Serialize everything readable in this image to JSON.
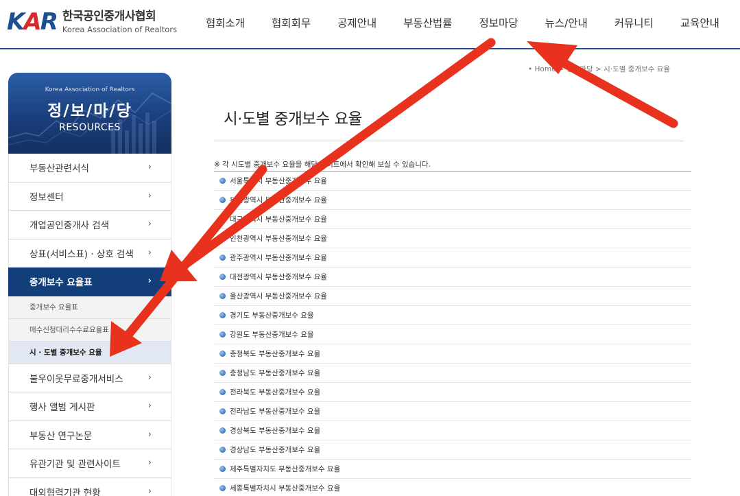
{
  "header": {
    "logo": {
      "mark_k": "K",
      "mark_a": "A",
      "mark_r": "R",
      "name_ko": "한국공인중개사협회",
      "name_en": "Korea Association of Realtors"
    },
    "nav": [
      "협회소개",
      "협회회무",
      "공제안내",
      "부동산법률",
      "정보마당",
      "뉴스/안내",
      "커뮤니티",
      "교육안내"
    ]
  },
  "sidebar": {
    "banner": {
      "org": "Korea Association of Realtors",
      "title": "정/보/마/당",
      "subtitle": "RESOURCES"
    },
    "items": [
      {
        "label": "부동산관련서식",
        "chevron": "›"
      },
      {
        "label": "정보센터",
        "chevron": "›"
      },
      {
        "label": "개업공인중개사 검색",
        "chevron": "›"
      },
      {
        "label": "상표(서비스표) · 상호 검색",
        "chevron": "›"
      },
      {
        "label": "중개보수 요율표",
        "chevron": "›"
      }
    ],
    "sub_items": [
      "중개보수 요율표",
      "매수신청대리수수료요율표",
      "시 · 도별 중개보수 요율"
    ],
    "items_after": [
      {
        "label": "불우이웃무료중개서비스",
        "chevron": "›"
      },
      {
        "label": "행사 앨범 게시판",
        "chevron": "›"
      },
      {
        "label": "부동산 연구논문",
        "chevron": "›"
      },
      {
        "label": "유관기관 및 관련사이트",
        "chevron": "›"
      },
      {
        "label": "대외협력기관 현황",
        "chevron": "›"
      }
    ]
  },
  "main": {
    "breadcrumb": "• Home > 정보마당 > 시·도별 중개보수 요율",
    "title": "시·도별 중개보수 요율",
    "notice": "※ 각 시도별 중개보수 요율을 해당 사이트에서 확인해 보실 수 있습니다.",
    "rows": [
      "서울특별시 부동산중개보수 요율",
      "부산광역시 부동산중개보수 요율",
      "대구광역시 부동산중개보수 요율",
      "인천광역시 부동산중개보수 요율",
      "광주광역시 부동산중개보수 요율",
      "대전광역시 부동산중개보수 요율",
      "울산광역시 부동산중개보수 요율",
      "경기도 부동산중개보수 요율",
      "강원도 부동산중개보수 요율",
      "충청북도 부동산중개보수 요율",
      "충청남도 부동산중개보수 요율",
      "전라북도 부동산중개보수 요율",
      "전라남도 부동산중개보수 요율",
      "경상북도 부동산중개보수 요율",
      "경상남도 부동산중개보수 요율",
      "제주특별자치도 부동산중개보수 요율",
      "세종특별자치시 부동산중개보수 요율"
    ]
  },
  "colors": {
    "brand_blue": "#1d4f91",
    "brand_red": "#d62b2b",
    "active_menu": "#123f7a",
    "annotation_arrow": "#e8321e"
  }
}
